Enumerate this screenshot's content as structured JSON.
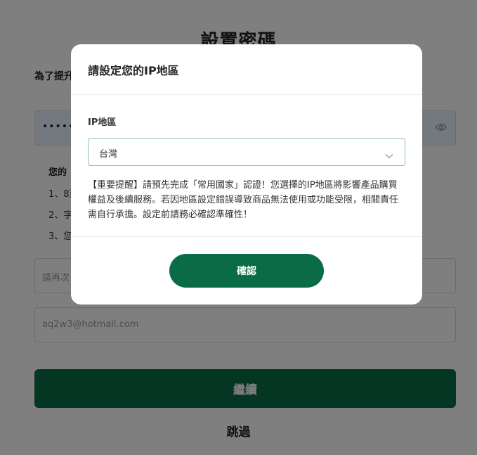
{
  "page": {
    "title": "設置密碼",
    "subtitle": "為了提升",
    "password_value": "••••••••",
    "rules_title": "您的",
    "rules": [
      "1、8至",
      "2、字",
      "3、您"
    ],
    "confirm_placeholder": "請再次",
    "email_value": "aq2w3@hotmail.com",
    "continue_label": "繼續",
    "skip_label": "跳過"
  },
  "modal": {
    "title": "請設定您的IP地區",
    "field_label": "IP地區",
    "selected_region": "台灣",
    "notice": "【重要提醒】請預先完成「常用國家」認證！您選擇的IP地區將影響產品購買權益及後續服務。若因地區設定錯誤導致商品無法使用或功能受限，相關責任需自行承擔。設定前請務必確認準確性！",
    "confirm_label": "確認"
  },
  "colors": {
    "primary": "#0a6b47",
    "overlay": "rgba(0,0,0,0.5)"
  },
  "icons": {
    "password_toggle": "eye-icon",
    "select_dropdown": "chevron-down-icon"
  }
}
